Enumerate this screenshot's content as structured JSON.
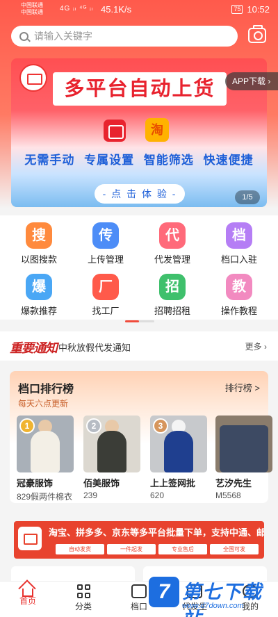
{
  "status": {
    "carrier1": "中国联通",
    "carrier2": "中国联通",
    "net": "4G ᵢₗ ⁴ᴳ ᵢₗ",
    "speed": "45.1K/s",
    "battery": "75",
    "time": "10:52"
  },
  "search": {
    "placeholder": "请输入关键字"
  },
  "banner": {
    "headline": "多平台自动上货",
    "app2_glyph": "淘",
    "features": [
      "无需手动",
      "专属设置",
      "智能筛选",
      "快速便捷"
    ],
    "cta": "- 点 击 体 验 -",
    "counter": "1/5"
  },
  "app_download": "APP下载 ›",
  "grid": [
    {
      "glyph": "搜",
      "label": "以图搜款",
      "color": "#ff8a3d"
    },
    {
      "glyph": "传",
      "label": "上传管理",
      "color": "#4d8df7"
    },
    {
      "glyph": "代",
      "label": "代发管理",
      "color": "#ff6a7a"
    },
    {
      "glyph": "档",
      "label": "档口入驻",
      "color": "#b57ef5"
    },
    {
      "glyph": "爆",
      "label": "爆款推荐",
      "color": "#4aa7f5"
    },
    {
      "glyph": "厂",
      "label": "找工厂",
      "color": "#ff5a4a"
    },
    {
      "glyph": "招",
      "label": "招聘招租",
      "color": "#3fc06c"
    },
    {
      "glyph": "教",
      "label": "操作教程",
      "color": "#f28ac0"
    }
  ],
  "notice": {
    "tag": "重要通知",
    "text": "中秋放假代发通知",
    "more": "更多 ›"
  },
  "rank": {
    "title": "档口排行榜",
    "subtitle": "每天六点更新",
    "more": "排行榜 >",
    "shops": [
      {
        "medal": "1",
        "name": "冠豪服饰",
        "meta": "829假两件棉衣"
      },
      {
        "medal": "2",
        "name": "佰美服饰",
        "meta": "239"
      },
      {
        "medal": "3",
        "name": "上上签网批",
        "meta": "620"
      },
      {
        "medal": "",
        "name": "艺汐先生",
        "meta": "M5568"
      }
    ]
  },
  "promo": {
    "headline": "淘宝、拼多多、京东等多平台批量下单，支持中通、邮政",
    "chips": [
      "自动发货",
      "一件起发",
      "专业售后",
      "全国可发"
    ]
  },
  "tabs": [
    {
      "label": "首页"
    },
    {
      "label": "分类"
    },
    {
      "label": "档口"
    },
    {
      "label": "代发生"
    },
    {
      "label": "我的"
    }
  ],
  "watermark": {
    "name": "第七下载站",
    "mark": "7",
    "url": "www.d7down.com"
  }
}
